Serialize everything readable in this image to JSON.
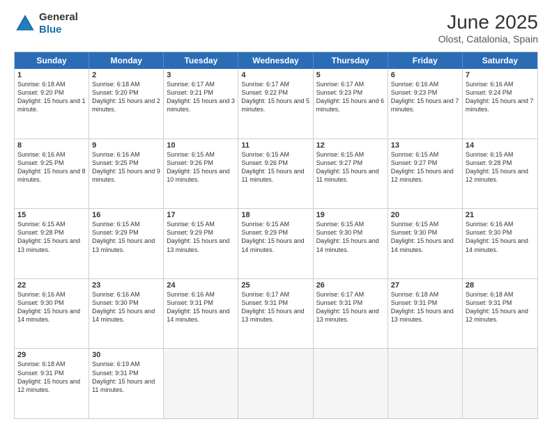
{
  "logo": {
    "general": "General",
    "blue": "Blue"
  },
  "header": {
    "title": "June 2025",
    "subtitle": "Olost, Catalonia, Spain"
  },
  "weekdays": [
    "Sunday",
    "Monday",
    "Tuesday",
    "Wednesday",
    "Thursday",
    "Friday",
    "Saturday"
  ],
  "weeks": [
    [
      {
        "day": "1",
        "sunrise": "Sunrise: 6:18 AM",
        "sunset": "Sunset: 9:20 PM",
        "daylight": "Daylight: 15 hours and 1 minute."
      },
      {
        "day": "2",
        "sunrise": "Sunrise: 6:18 AM",
        "sunset": "Sunset: 9:20 PM",
        "daylight": "Daylight: 15 hours and 2 minutes."
      },
      {
        "day": "3",
        "sunrise": "Sunrise: 6:17 AM",
        "sunset": "Sunset: 9:21 PM",
        "daylight": "Daylight: 15 hours and 3 minutes."
      },
      {
        "day": "4",
        "sunrise": "Sunrise: 6:17 AM",
        "sunset": "Sunset: 9:22 PM",
        "daylight": "Daylight: 15 hours and 5 minutes."
      },
      {
        "day": "5",
        "sunrise": "Sunrise: 6:17 AM",
        "sunset": "Sunset: 9:23 PM",
        "daylight": "Daylight: 15 hours and 6 minutes."
      },
      {
        "day": "6",
        "sunrise": "Sunrise: 6:16 AM",
        "sunset": "Sunset: 9:23 PM",
        "daylight": "Daylight: 15 hours and 7 minutes."
      },
      {
        "day": "7",
        "sunrise": "Sunrise: 6:16 AM",
        "sunset": "Sunset: 9:24 PM",
        "daylight": "Daylight: 15 hours and 7 minutes."
      }
    ],
    [
      {
        "day": "8",
        "sunrise": "Sunrise: 6:16 AM",
        "sunset": "Sunset: 9:25 PM",
        "daylight": "Daylight: 15 hours and 8 minutes."
      },
      {
        "day": "9",
        "sunrise": "Sunrise: 6:16 AM",
        "sunset": "Sunset: 9:25 PM",
        "daylight": "Daylight: 15 hours and 9 minutes."
      },
      {
        "day": "10",
        "sunrise": "Sunrise: 6:15 AM",
        "sunset": "Sunset: 9:26 PM",
        "daylight": "Daylight: 15 hours and 10 minutes."
      },
      {
        "day": "11",
        "sunrise": "Sunrise: 6:15 AM",
        "sunset": "Sunset: 9:26 PM",
        "daylight": "Daylight: 15 hours and 11 minutes."
      },
      {
        "day": "12",
        "sunrise": "Sunrise: 6:15 AM",
        "sunset": "Sunset: 9:27 PM",
        "daylight": "Daylight: 15 hours and 11 minutes."
      },
      {
        "day": "13",
        "sunrise": "Sunrise: 6:15 AM",
        "sunset": "Sunset: 9:27 PM",
        "daylight": "Daylight: 15 hours and 12 minutes."
      },
      {
        "day": "14",
        "sunrise": "Sunrise: 6:15 AM",
        "sunset": "Sunset: 9:28 PM",
        "daylight": "Daylight: 15 hours and 12 minutes."
      }
    ],
    [
      {
        "day": "15",
        "sunrise": "Sunrise: 6:15 AM",
        "sunset": "Sunset: 9:28 PM",
        "daylight": "Daylight: 15 hours and 13 minutes."
      },
      {
        "day": "16",
        "sunrise": "Sunrise: 6:15 AM",
        "sunset": "Sunset: 9:29 PM",
        "daylight": "Daylight: 15 hours and 13 minutes."
      },
      {
        "day": "17",
        "sunrise": "Sunrise: 6:15 AM",
        "sunset": "Sunset: 9:29 PM",
        "daylight": "Daylight: 15 hours and 13 minutes."
      },
      {
        "day": "18",
        "sunrise": "Sunrise: 6:15 AM",
        "sunset": "Sunset: 9:29 PM",
        "daylight": "Daylight: 15 hours and 14 minutes."
      },
      {
        "day": "19",
        "sunrise": "Sunrise: 6:15 AM",
        "sunset": "Sunset: 9:30 PM",
        "daylight": "Daylight: 15 hours and 14 minutes."
      },
      {
        "day": "20",
        "sunrise": "Sunrise: 6:15 AM",
        "sunset": "Sunset: 9:30 PM",
        "daylight": "Daylight: 15 hours and 14 minutes."
      },
      {
        "day": "21",
        "sunrise": "Sunrise: 6:16 AM",
        "sunset": "Sunset: 9:30 PM",
        "daylight": "Daylight: 15 hours and 14 minutes."
      }
    ],
    [
      {
        "day": "22",
        "sunrise": "Sunrise: 6:16 AM",
        "sunset": "Sunset: 9:30 PM",
        "daylight": "Daylight: 15 hours and 14 minutes."
      },
      {
        "day": "23",
        "sunrise": "Sunrise: 6:16 AM",
        "sunset": "Sunset: 9:30 PM",
        "daylight": "Daylight: 15 hours and 14 minutes."
      },
      {
        "day": "24",
        "sunrise": "Sunrise: 6:16 AM",
        "sunset": "Sunset: 9:31 PM",
        "daylight": "Daylight: 15 hours and 14 minutes."
      },
      {
        "day": "25",
        "sunrise": "Sunrise: 6:17 AM",
        "sunset": "Sunset: 9:31 PM",
        "daylight": "Daylight: 15 hours and 13 minutes."
      },
      {
        "day": "26",
        "sunrise": "Sunrise: 6:17 AM",
        "sunset": "Sunset: 9:31 PM",
        "daylight": "Daylight: 15 hours and 13 minutes."
      },
      {
        "day": "27",
        "sunrise": "Sunrise: 6:18 AM",
        "sunset": "Sunset: 9:31 PM",
        "daylight": "Daylight: 15 hours and 13 minutes."
      },
      {
        "day": "28",
        "sunrise": "Sunrise: 6:18 AM",
        "sunset": "Sunset: 9:31 PM",
        "daylight": "Daylight: 15 hours and 12 minutes."
      }
    ],
    [
      {
        "day": "29",
        "sunrise": "Sunrise: 6:18 AM",
        "sunset": "Sunset: 9:31 PM",
        "daylight": "Daylight: 15 hours and 12 minutes."
      },
      {
        "day": "30",
        "sunrise": "Sunrise: 6:19 AM",
        "sunset": "Sunset: 9:31 PM",
        "daylight": "Daylight: 15 hours and 11 minutes."
      },
      null,
      null,
      null,
      null,
      null
    ]
  ]
}
